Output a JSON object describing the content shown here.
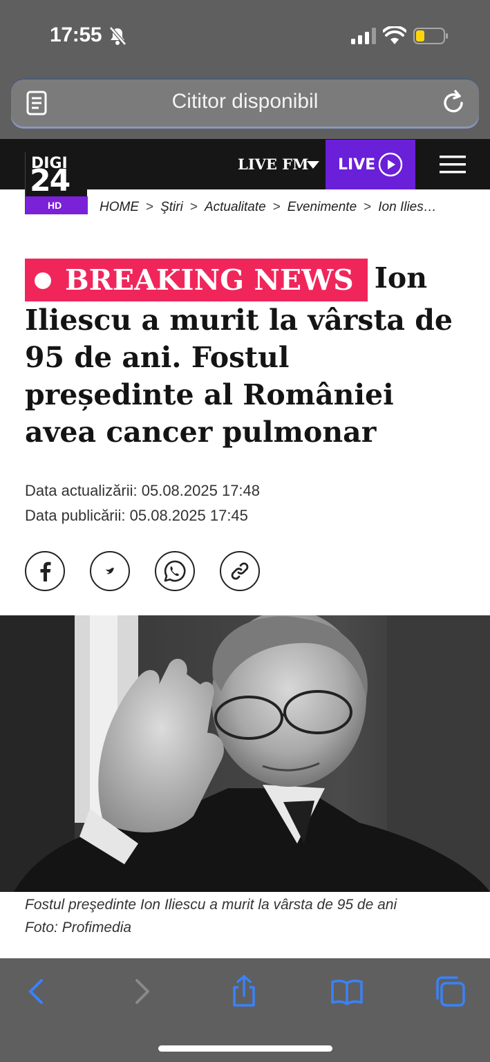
{
  "status_bar": {
    "time": "17:55"
  },
  "url_bar": {
    "text": "Cititor disponibil"
  },
  "site": {
    "logo_top": "DIGI",
    "logo_number": "24",
    "logo_hd": "HD",
    "live_fm_label": "LIVE FM",
    "live_label": "LIVE"
  },
  "breadcrumb": [
    {
      "label": "HOME"
    },
    {
      "label": "Ştiri"
    },
    {
      "label": "Actualitate"
    },
    {
      "label": "Evenimente"
    },
    {
      "label": "Ion Ilies…"
    }
  ],
  "breadcrumb_separator": ">",
  "article": {
    "badge": "BREAKING NEWS",
    "title": "Ion Iliescu a murit la vârsta de 95 de ani. Fostul președinte al României avea cancer pulmonar",
    "updated": "Data actualizării: 05.08.2025 17:48",
    "published": "Data publicării: 05.08.2025 17:45",
    "caption_line1": "Fostul preşedinte Ion Iliescu a murit la vârsta de 95 de ani",
    "caption_line2": "Foto: Profimedia"
  },
  "share_buttons": [
    {
      "icon": "facebook-icon"
    },
    {
      "icon": "twitter-icon"
    },
    {
      "icon": "whatsapp-icon"
    },
    {
      "icon": "link-icon"
    }
  ],
  "toolbar": [
    "back-icon",
    "forward-icon",
    "share-icon",
    "bookmarks-icon",
    "tabs-icon"
  ],
  "colors": {
    "breaking": "#f0265b",
    "live": "#6a1fd8",
    "header": "#161616",
    "ios_accent": "#3a82f7"
  }
}
